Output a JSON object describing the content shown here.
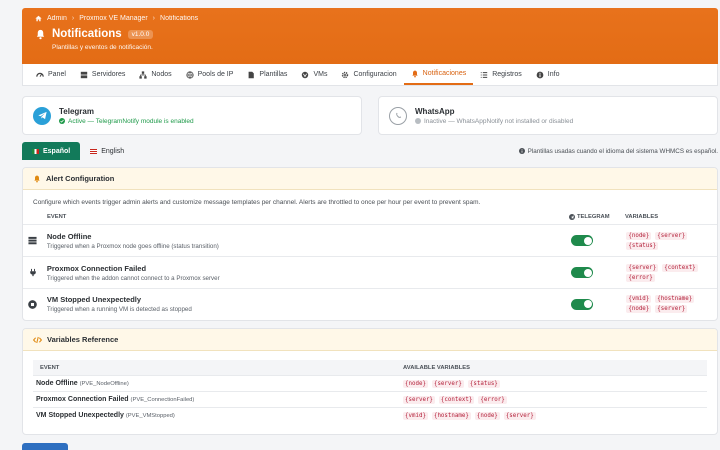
{
  "breadcrumb": [
    "Admin",
    "Proxmox VE Manager",
    "Notifications"
  ],
  "header": {
    "title": "Notifications",
    "version": "v1.0.0",
    "subtitle": "Plantillas y eventos de notificación."
  },
  "tabs": [
    {
      "label": "Panel",
      "icon": "gauge-icon"
    },
    {
      "label": "Servidores",
      "icon": "server-icon"
    },
    {
      "label": "Nodos",
      "icon": "nodes-icon"
    },
    {
      "label": "Pools de IP",
      "icon": "globe-icon"
    },
    {
      "label": "Plantillas",
      "icon": "file-icon"
    },
    {
      "label": "VMs",
      "icon": "vm-icon"
    },
    {
      "label": "Configuracion",
      "icon": "gear-icon"
    },
    {
      "label": "Notificaciones",
      "icon": "bell-icon",
      "active": true
    },
    {
      "label": "Registros",
      "icon": "list-icon"
    },
    {
      "label": "Info",
      "icon": "info-icon"
    }
  ],
  "channels": {
    "telegram": {
      "name": "Telegram",
      "status": "Active — TelegramNotify module is enabled",
      "color": "#1f9a4a"
    },
    "whatsapp": {
      "name": "WhatsApp",
      "status": "Inactive — WhatsAppNotify not installed or disabled",
      "color": "#8a9097"
    }
  },
  "languages": {
    "es": "Español",
    "en": "English",
    "note": "Plantillas usadas cuando el idioma del sistema WHMCS es español."
  },
  "alert_config": {
    "title": "Alert Configuration",
    "description": "Configure which events trigger admin alerts and customize message templates per channel. Alerts are throttled to once per hour per event to prevent spam.",
    "col_event": "Event",
    "col_telegram": "Telegram",
    "col_vars": "Variables",
    "events": [
      {
        "name": "Node Offline",
        "desc": "Triggered when a Proxmox node goes offline (status transition)",
        "icon": "server-stack-icon",
        "enabled": true,
        "vars": [
          "{node}",
          "{server}",
          "{status}"
        ]
      },
      {
        "name": "Proxmox Connection Failed",
        "desc": "Triggered when the addon cannot connect to a Proxmox server",
        "icon": "plug-icon",
        "enabled": true,
        "vars": [
          "{server}",
          "{context}",
          "{error}"
        ]
      },
      {
        "name": "VM Stopped Unexpectedly",
        "desc": "Triggered when a running VM is detected as stopped",
        "icon": "stop-circle-icon",
        "enabled": true,
        "vars": [
          "{vmid}",
          "{hostname}",
          "{node}",
          "{server}"
        ]
      }
    ]
  },
  "vars_ref": {
    "title": "Variables Reference",
    "col_event": "Event",
    "col_vars": "Available Variables",
    "rows": [
      {
        "name": "Node Offline",
        "code": "(PVE_NodeOffline)",
        "vars": [
          "{node}",
          "{server}",
          "{status}"
        ]
      },
      {
        "name": "Proxmox Connection Failed",
        "code": "(PVE_ConnectionFailed)",
        "vars": [
          "{server}",
          "{context}",
          "{error}"
        ]
      },
      {
        "name": "VM Stopped Unexpectedly",
        "code": "(PVE_VMStopped)",
        "vars": [
          "{vmid}",
          "{hostname}",
          "{node}",
          "{server}"
        ]
      }
    ]
  },
  "colors": {
    "brand": "#e36c15",
    "active_lang": "#127a5a",
    "toggle_on": "#1f8a4c",
    "primary_button": "#2e6fc0"
  }
}
